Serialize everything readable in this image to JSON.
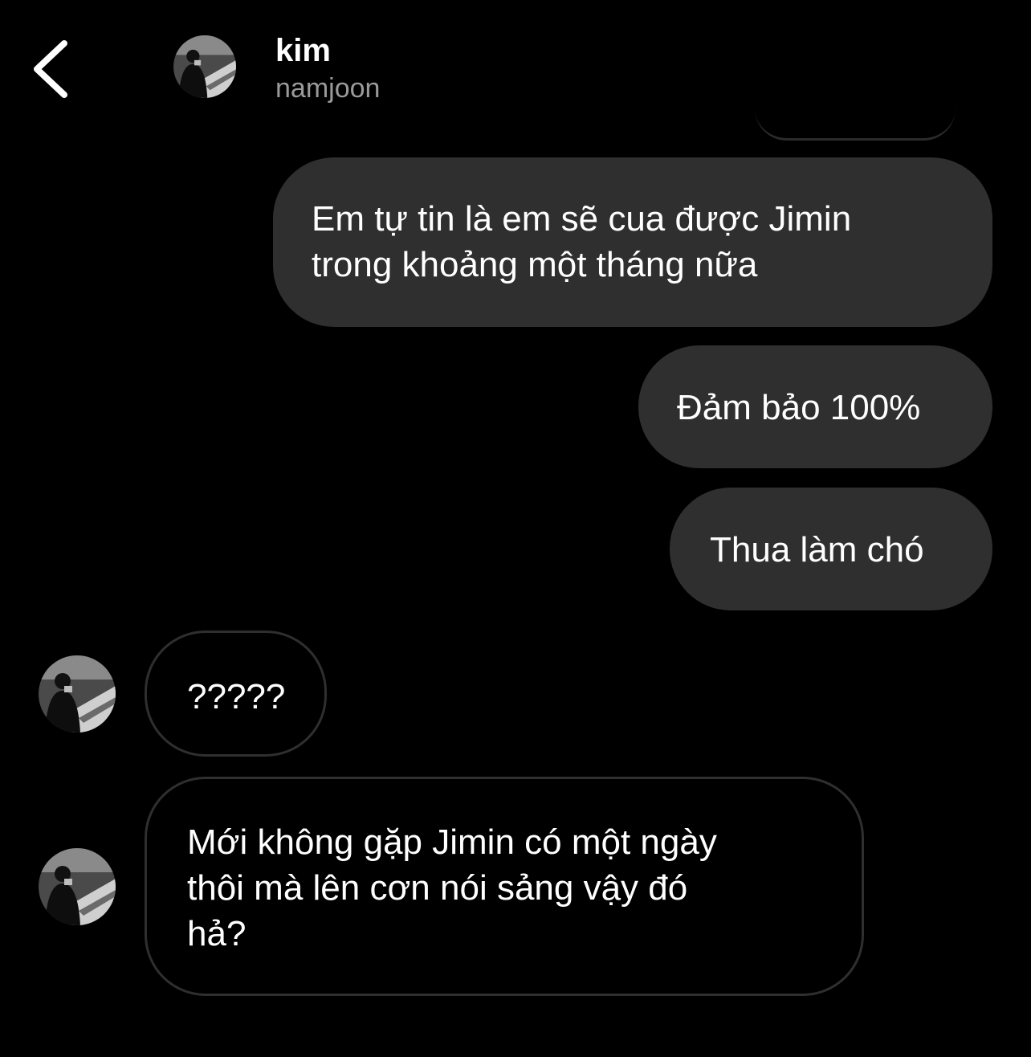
{
  "header": {
    "name": "kim",
    "username": "namjoon",
    "back_icon": "chevron-left-icon"
  },
  "messages": [
    {
      "direction": "sent",
      "text": "Em tự tin là em sẽ cua được Jimin\ntrong khoảng một tháng nữa"
    },
    {
      "direction": "sent",
      "text": "Đảm bảo 100%"
    },
    {
      "direction": "sent",
      "text": "Thua làm chó"
    },
    {
      "direction": "received",
      "text": "?????"
    },
    {
      "direction": "received",
      "text": "Mới không gặp Jimin có một ngày\nthôi mà lên cơn nói sảng vậy đó\nhả?"
    }
  ],
  "colors": {
    "background": "#000000",
    "sent_bubble": "#2f2f2f",
    "received_border": "#2f2f2f",
    "text": "#ffffff",
    "secondary_text": "#9a9a9a"
  }
}
